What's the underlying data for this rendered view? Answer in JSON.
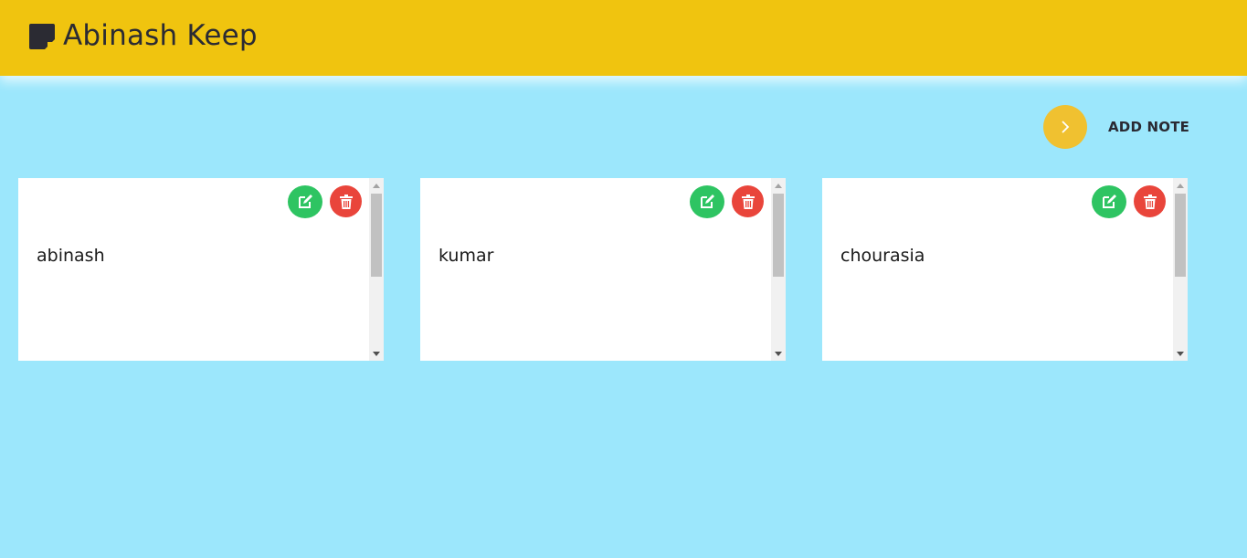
{
  "header": {
    "title": "Abinash Keep",
    "logo_icon": "sticky-note-icon",
    "background": "#f0c40f"
  },
  "toolbar": {
    "add_label": "ADD NOTE",
    "add_icon": "chevron-right-icon",
    "add_color": "#f0c130"
  },
  "notes": [
    {
      "text": "abinash"
    },
    {
      "text": "kumar"
    },
    {
      "text": "chourasia"
    }
  ],
  "colors": {
    "page_background": "#9ce7fc",
    "edit": "#2ec462",
    "delete": "#e9453b"
  }
}
